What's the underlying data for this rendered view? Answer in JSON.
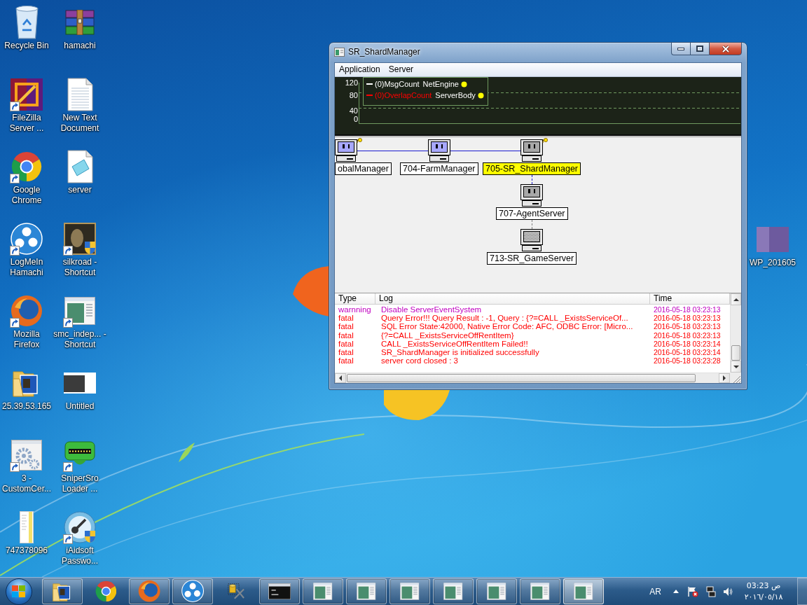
{
  "desktop_icons": [
    {
      "label": "Recycle Bin",
      "kind": "bin",
      "shortcut": false
    },
    {
      "label": "hamachi",
      "kind": "archive",
      "shortcut": false
    },
    {
      "label": "FileZilla Server ...",
      "kind": "filezilla",
      "shortcut": true
    },
    {
      "label": "New Text Document",
      "kind": "text",
      "shortcut": false
    },
    {
      "label": "Google Chrome",
      "kind": "chrome",
      "shortcut": true
    },
    {
      "label": "server",
      "kind": "notepad",
      "shortcut": false
    },
    {
      "label": "LogMeIn Hamachi",
      "kind": "hamachi",
      "shortcut": true
    },
    {
      "label": "silkroad - Shortcut",
      "kind": "game",
      "shortcut": true
    },
    {
      "label": "Mozilla Firefox",
      "kind": "firefox",
      "shortcut": true
    },
    {
      "label": "smc_indep... - Shortcut",
      "kind": "window",
      "shortcut": true
    },
    {
      "label": "25.39.53.165",
      "kind": "folder",
      "shortcut": false
    },
    {
      "label": "Untitled",
      "kind": "image",
      "shortcut": false
    },
    {
      "label": "3 - CustomCer...",
      "kind": "gears",
      "shortcut": true
    },
    {
      "label": "SniperSro Loader ...",
      "kind": "robot",
      "shortcut": true
    },
    {
      "label": "747378096",
      "kind": "page",
      "shortcut": false
    },
    {
      "label": "iAidsoft Passwo...",
      "kind": "key",
      "shortcut": true
    }
  ],
  "side_desktop_icons": [
    {
      "label": "WP_201605",
      "kind": "photo",
      "shortcut": false
    }
  ],
  "window": {
    "title": "SR_ShardManager",
    "menu": [
      "Application",
      "Server"
    ],
    "graph": {
      "y_labels": [
        "120",
        "80",
        "40",
        "0"
      ],
      "legend": [
        {
          "counter": "(0)MsgCount",
          "source": "NetEngine",
          "color": "#ffffff"
        },
        {
          "counter": "(0)OverlapCount",
          "source": "ServerBody",
          "color": "#ff0000"
        }
      ]
    },
    "nodes": [
      {
        "label": "obalManager",
        "color": "#a8a8ff",
        "hatched": false,
        "plug": true,
        "selected": false
      },
      {
        "label": "704-FarmManager",
        "color": "#a8a8ff",
        "hatched": false,
        "plug": false,
        "selected": false,
        "connector": {
          "color": "#1c1cd0",
          "dashed": false
        }
      },
      {
        "label": "705-SR_ShardManager",
        "color": "#a8a8a8",
        "hatched": false,
        "plug": true,
        "selected": true,
        "connector": {
          "color": "#1c1cd0",
          "dashed": false
        },
        "children": [
          {
            "label": "707-AgentServer",
            "color": "#a8a8a8",
            "hatched": false,
            "plug": false,
            "selected": false,
            "connector": {
              "color": "#1c1cd0",
              "dashed": true
            },
            "children": [
              {
                "label": "713-SR_GameServer",
                "color": "#c8c8c8",
                "hatched": true,
                "plug": false,
                "selected": false,
                "connector": {
                  "color": "#808080",
                  "dashed": true
                }
              }
            ]
          }
        ]
      }
    ],
    "log": {
      "columns": [
        "Type",
        "Log",
        "Time"
      ],
      "rows": [
        {
          "type": "warnning",
          "message": "Disable ServerEventSystem",
          "time": "2016-05-18 03:23:13",
          "color": "#c000c0"
        },
        {
          "type": "fatal",
          "message": "Query Error!!! Query Result : -1, Query : {?=CALL _ExistsServiceOf...",
          "time": "2016-05-18 03:23:13",
          "color": "#ff0000"
        },
        {
          "type": "fatal",
          "message": "SQL Error State:42000, Native Error Code: AFC, ODBC Error: [Micro...",
          "time": "2016-05-18 03:23:13",
          "color": "#ff0000"
        },
        {
          "type": "fatal",
          "message": "{?=CALL _ExistsServiceOffRentItem}",
          "time": "2016-05-18 03:23:13",
          "color": "#ff0000"
        },
        {
          "type": "fatal",
          "message": "CALL _ExistsServiceOffRentItem Failed!!",
          "time": "2016-05-18 03:23:14",
          "color": "#ff0000"
        },
        {
          "type": "fatal",
          "message": "SR_ShardManager is initialized successfully",
          "time": "2016-05-18 03:23:14",
          "color": "#ff0000"
        },
        {
          "type": "fatal",
          "message": "server cord closed : 3",
          "time": "2016-05-18 03:23:28",
          "color": "#ff0000"
        }
      ]
    }
  },
  "taskbar": {
    "buttons": [
      {
        "kind": "folder",
        "running": true,
        "selected": false
      },
      {
        "kind": "chrome",
        "running": false,
        "selected": false
      },
      {
        "kind": "firefox",
        "running": true,
        "selected": false
      },
      {
        "kind": "hamachi",
        "running": true,
        "selected": false
      },
      {
        "kind": "tools",
        "running": false,
        "selected": false
      },
      {
        "kind": "console",
        "running": true,
        "selected": false
      },
      {
        "kind": "window",
        "running": true,
        "selected": false
      },
      {
        "kind": "window",
        "running": true,
        "selected": false
      },
      {
        "kind": "window",
        "running": true,
        "selected": false
      },
      {
        "kind": "window",
        "running": true,
        "selected": false
      },
      {
        "kind": "window",
        "running": true,
        "selected": false
      },
      {
        "kind": "window",
        "running": true,
        "selected": false
      },
      {
        "kind": "window",
        "running": true,
        "selected": true
      }
    ],
    "language": "AR",
    "time": "03:23 ص",
    "date": "٢٠١٦/٠٥/١٨"
  }
}
